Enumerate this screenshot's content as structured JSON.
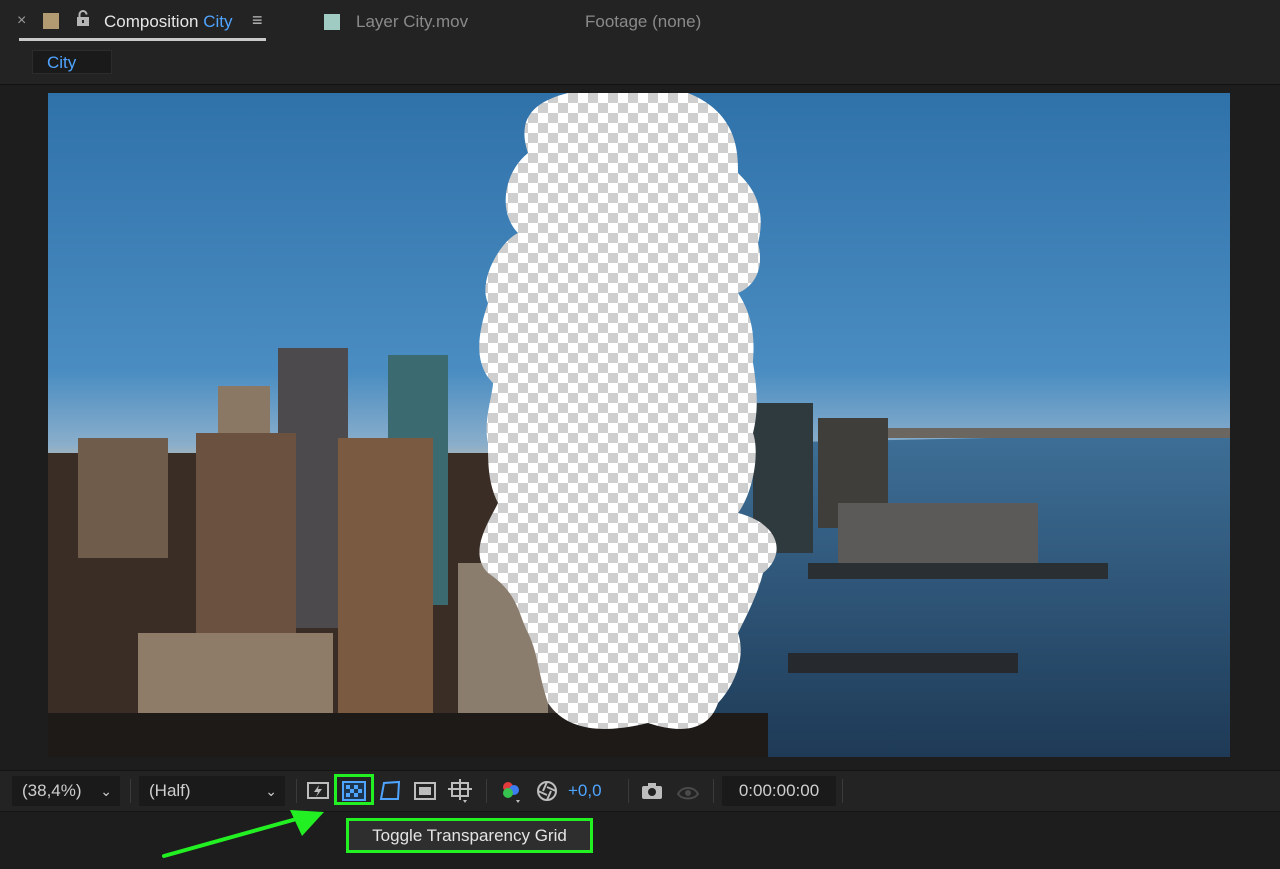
{
  "tabs": {
    "active": {
      "close_glyph": "×",
      "prefix": "Composition",
      "name": "City",
      "menu_glyph": "≡",
      "swatch_color": "#b29a72"
    },
    "layer": {
      "label": "Layer City.mov",
      "swatch_color": "#9fcbc3"
    },
    "footage": {
      "label": "Footage (none)"
    }
  },
  "breadcrumb": {
    "label": "City"
  },
  "viewer": {
    "content": "city-skyline-with-transparent-region",
    "transparency_grid": true
  },
  "toolbar": {
    "zoom": "(38,4%)",
    "resolution": "(Half)",
    "exposure": "+0,0",
    "timecode": "0:00:00:00",
    "icons": [
      "fast-previews-icon",
      "transparency-grid-icon",
      "mask-path-icon",
      "region-of-interest-icon",
      "grid-guides-icon",
      "color-channels-icon",
      "reset-exposure-icon",
      "snapshot-icon",
      "show-snapshot-icon"
    ]
  },
  "tooltip": {
    "text": "Toggle Transparency Grid"
  },
  "colors": {
    "accent": "#4fa4ff",
    "highlight": "#22f022",
    "panel": "#232323"
  }
}
